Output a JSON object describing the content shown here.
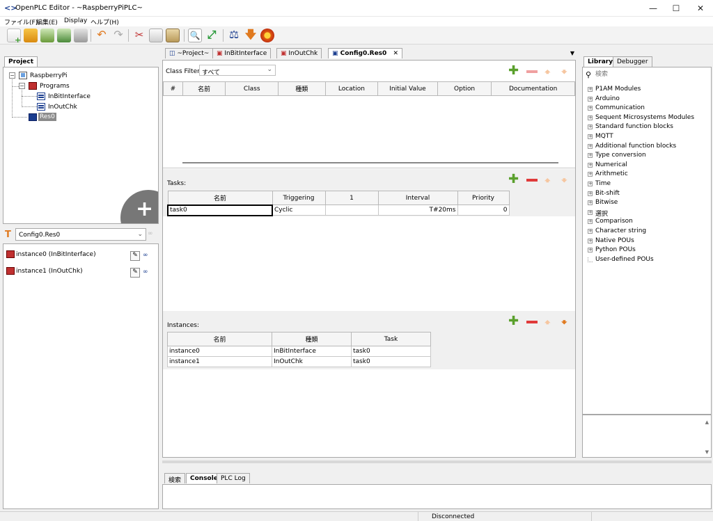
{
  "window": {
    "title": "OpenPLC Editor - ~RaspberryPiPLC~"
  },
  "menu": [
    "ファイル(F)",
    "編集(E)",
    "Display",
    "ヘルプ(H)"
  ],
  "project_panel": {
    "tab": "Project",
    "tree": {
      "root": "RaspberryPi",
      "programs": "Programs",
      "items": [
        "InBitInterface",
        "InOutChk"
      ],
      "resource": "Res0"
    },
    "selector": "Config0.Res0",
    "instances": [
      "instance0 (InBitInterface)",
      "instance1 (InOutChk)"
    ]
  },
  "editor": {
    "tabs": [
      "~Project~",
      "InBitInterface",
      "InOutChk",
      "Config0.Res0"
    ],
    "class_filter_label": "Class Filter:",
    "class_filter_value": "すべて",
    "variables_columns": [
      "#",
      "名前",
      "Class",
      "種類",
      "Location",
      "Initial Value",
      "Option",
      "Documentation"
    ],
    "tasks_label": "Tasks:",
    "tasks_columns": [
      "名前",
      "Triggering",
      "1",
      "Interval",
      "Priority"
    ],
    "tasks_rows": [
      {
        "name": "task0",
        "triggering": "Cyclic",
        "single": "",
        "interval": "T#20ms",
        "priority": "0"
      }
    ],
    "instances_label": "Instances:",
    "instances_columns": [
      "名前",
      "種類",
      "Task"
    ],
    "instances_rows": [
      {
        "name": "instance0",
        "type": "InBitInterface",
        "task": "task0"
      },
      {
        "name": "instance1",
        "type": "InOutChk",
        "task": "task0"
      }
    ]
  },
  "library_panel": {
    "tabs": [
      "Library",
      "Debugger"
    ],
    "search_placeholder": "検索",
    "items": [
      "P1AM Modules",
      "Arduino",
      "Communication",
      "Sequent Microsystems Modules",
      "Standard function blocks",
      "MQTT",
      "Additional function blocks",
      "Type conversion",
      "Numerical",
      "Arithmetic",
      "Time",
      "Bit-shift",
      "Bitwise",
      "選択",
      "Comparison",
      "Character string",
      "Native POUs",
      "Python POUs",
      "User-defined POUs"
    ]
  },
  "bottom_panel": {
    "tabs": [
      "検索",
      "Console",
      "PLC Log"
    ]
  },
  "status": {
    "text": "Disconnected"
  },
  "colors": {
    "accent_blue": "#1a3d8f",
    "add_green": "#5aa02c",
    "remove_red": "#e03a3a",
    "arrow_orange": "#f0a040"
  }
}
